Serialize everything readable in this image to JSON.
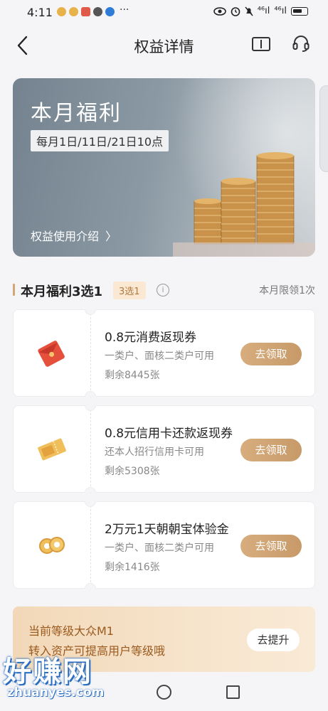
{
  "status_bar": {
    "time": "4:11",
    "dots": "···",
    "signal_1": "⁴⁶ıl",
    "signal_2": "⁴⁶ıl"
  },
  "nav": {
    "title": "权益详情",
    "back_icon": "chevron-left-icon",
    "ticket_icon": "ticket-icon",
    "service_icon": "headset-icon"
  },
  "banner": {
    "title": "本月福利",
    "dates": "每月1日/11日/21日10点",
    "intro_link": "权益使用介绍",
    "intro_arrow": "〉"
  },
  "section": {
    "title": "本月福利3选1",
    "tag": "3选1",
    "info_icon": "i",
    "limit": "本月限领1次"
  },
  "coupons": [
    {
      "title": "0.8元消费返现券",
      "subtitle": "一类户、面核二类户可用",
      "remaining": "剩余8445张",
      "button": "去领取",
      "icon": "red-envelope-icon"
    },
    {
      "title": "0.8元信用卡还款返现券",
      "subtitle": "还本人招行信用卡可用",
      "remaining": "剩余5308张",
      "button": "去领取",
      "icon": "gold-ticket-icon"
    },
    {
      "title": "2万元1天朝朝宝体验金",
      "subtitle": "一类户、面核二类户可用",
      "remaining": "剩余1416张",
      "button": "去领取",
      "icon": "gold-coins-icon"
    }
  ],
  "level": {
    "line1": "当前等级大众M1",
    "line2": "转入资产可提高用户等级哦",
    "button": "去提升"
  },
  "watermark": {
    "brand": "好赚网",
    "url": "zhuanyes.com"
  },
  "colors": {
    "accent_gold": "#d3a775",
    "button_gold": "#c79a68",
    "level_text": "#9a5a1e",
    "background": "#f5f5f7"
  }
}
